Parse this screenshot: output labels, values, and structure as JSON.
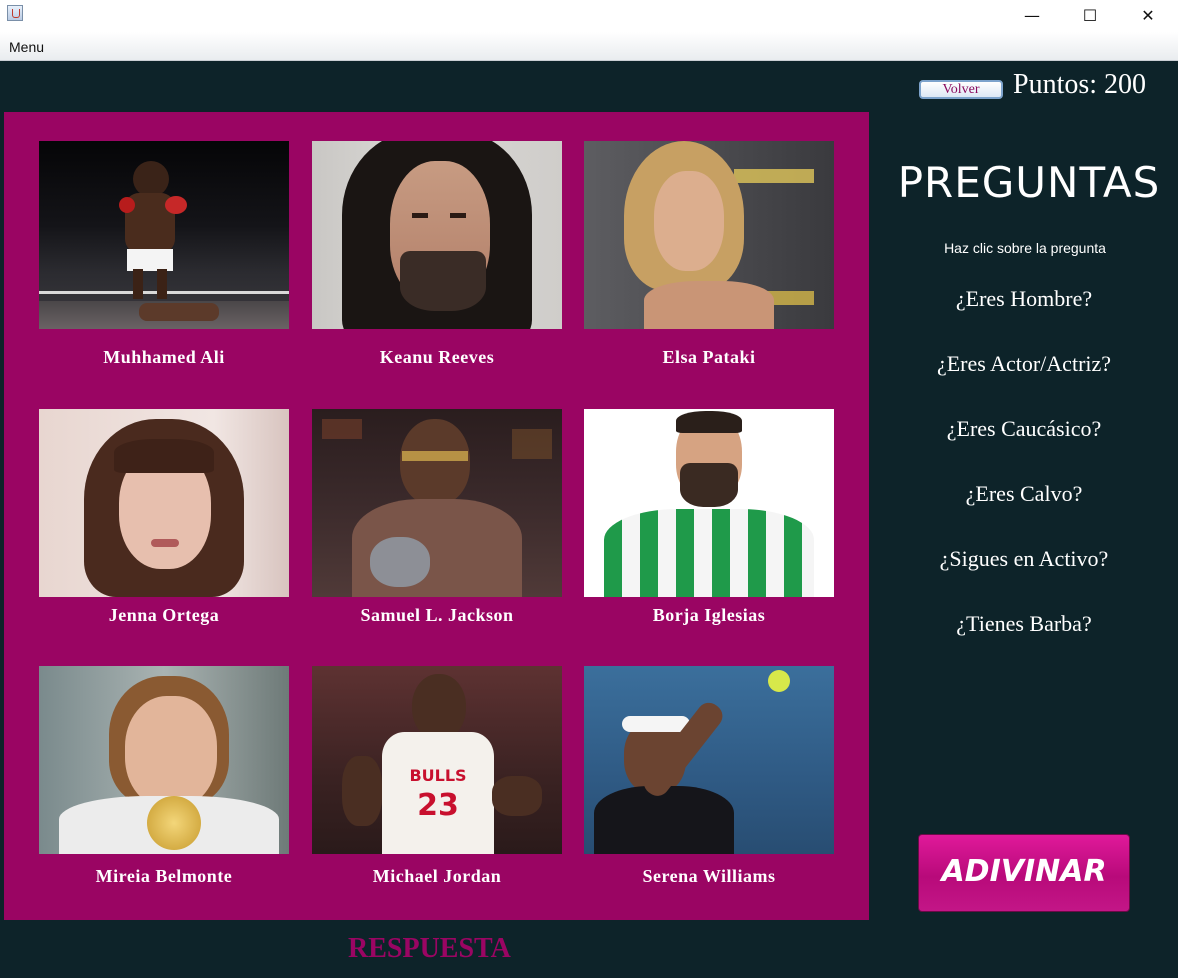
{
  "window": {
    "minimize": "—",
    "maximize": "☐",
    "close": "✕"
  },
  "menubar": {
    "menu_label": "Menu"
  },
  "header": {
    "volver_label": "Volver",
    "puntos_label": "Puntos: 200"
  },
  "cards": [
    {
      "name": "Muhhamed Ali"
    },
    {
      "name": "Keanu Reeves"
    },
    {
      "name": "Elsa Pataki"
    },
    {
      "name": "Jenna Ortega"
    },
    {
      "name": "Samuel L. Jackson"
    },
    {
      "name": "Borja Iglesias"
    },
    {
      "name": "Mireia Belmonte"
    },
    {
      "name": "Michael Jordan"
    },
    {
      "name": "Serena Williams"
    }
  ],
  "preguntas": {
    "title": "PREGUNTAS",
    "hint": "Haz clic sobre la pregunta",
    "items": [
      "¿Eres Hombre?",
      "¿Eres Actor/Actriz?",
      "¿Eres Caucásico?",
      "¿Eres Calvo?",
      "¿Sigues en Activo?",
      "¿Tienes Barba?"
    ]
  },
  "adivinar_label": "ADIVINAR",
  "respuesta_label": "RESPUESTA",
  "colors": {
    "background": "#0d2329",
    "board": "#9a0563",
    "accent": "#d0128a"
  }
}
